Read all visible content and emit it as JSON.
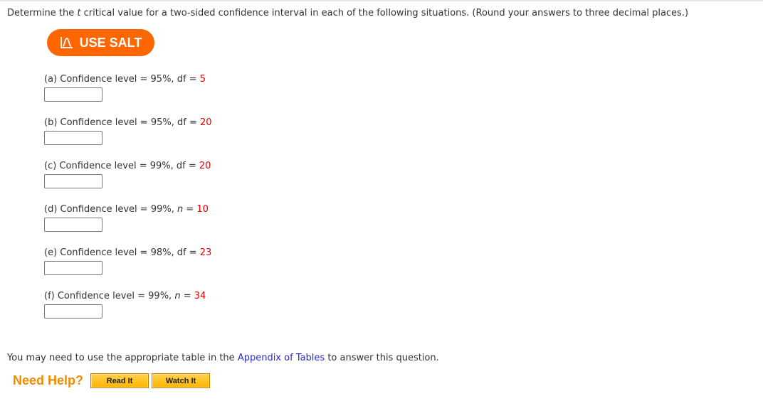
{
  "prompt": {
    "before_italic": "Determine the ",
    "italic": "t",
    "after_italic": " critical value for a two-sided confidence interval in each of the following situations. (Round your answers to three decimal places.)"
  },
  "salt_button": {
    "label": "USE SALT",
    "icon": "salt-curve-icon",
    "color": "#ff6600"
  },
  "parts": [
    {
      "prefix": "(a) Confidence level = 95%, ",
      "var": "df",
      "var_italic": false,
      "eq": " = ",
      "value": "5",
      "answer": ""
    },
    {
      "prefix": "(b) Confidence level = 95%, ",
      "var": "df",
      "var_italic": false,
      "eq": " = ",
      "value": "20",
      "answer": ""
    },
    {
      "prefix": "(c) Confidence level = 99%, ",
      "var": "df",
      "var_italic": false,
      "eq": " = ",
      "value": "20",
      "answer": ""
    },
    {
      "prefix": "(d) Confidence level = 99%, ",
      "var": "n",
      "var_italic": true,
      "eq": " = ",
      "value": "10",
      "answer": ""
    },
    {
      "prefix": "(e) Confidence level = 98%, ",
      "var": "df",
      "var_italic": false,
      "eq": " = ",
      "value": "23",
      "answer": ""
    },
    {
      "prefix": "(f) Confidence level = 99%, ",
      "var": "n",
      "var_italic": true,
      "eq": " = ",
      "value": "34",
      "answer": ""
    }
  ],
  "note": {
    "before_link": "You may need to use the appropriate table in the ",
    "link": "Appendix of Tables",
    "after_link": " to answer this question."
  },
  "help": {
    "label": "Need Help?",
    "read_it": "Read It",
    "watch_it": "Watch It"
  },
  "colors": {
    "value_red": "#e00000",
    "accent_orange": "#ff6600",
    "help_orange": "#f08c00",
    "link_blue": "#2a2acf"
  }
}
